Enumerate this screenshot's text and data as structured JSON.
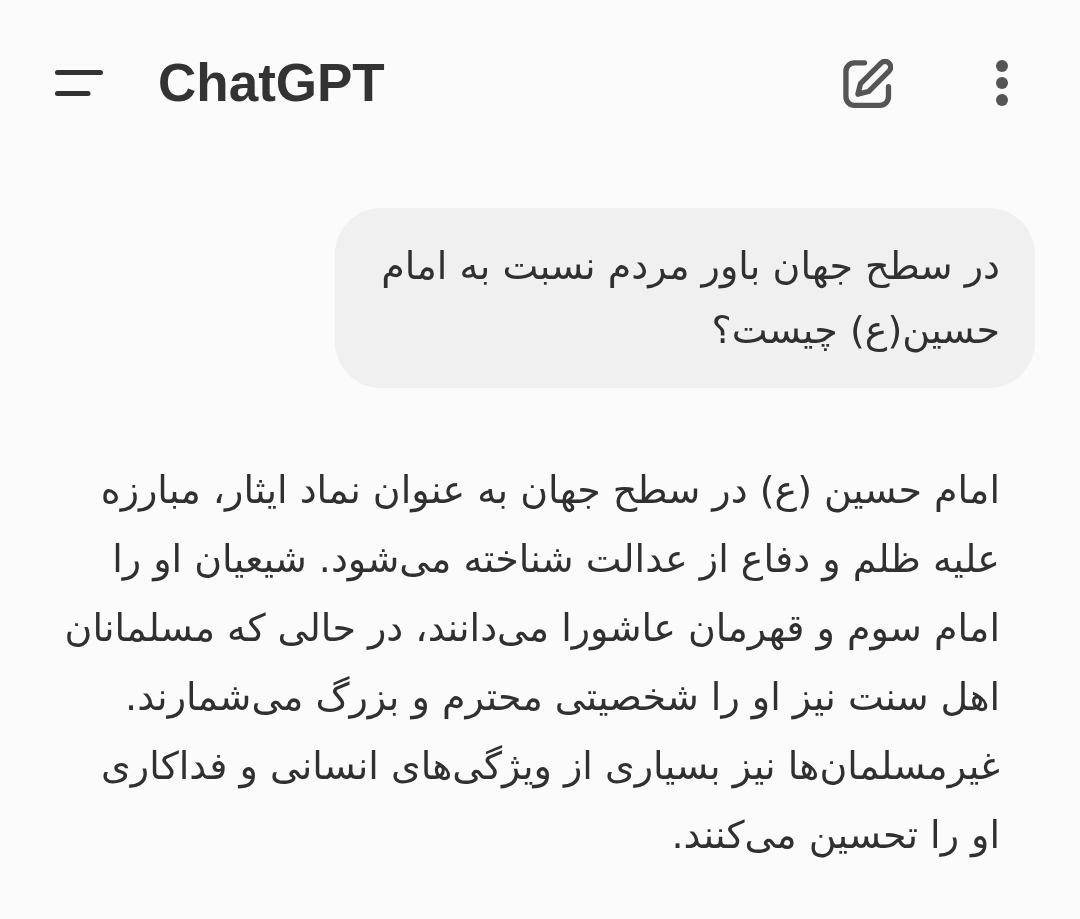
{
  "header": {
    "title": "ChatGPT"
  },
  "messages": [
    {
      "kind": "user",
      "text": "در سطح جهان باور مردم نسبت به امام حسین(ع) چیست؟"
    },
    {
      "kind": "assistant",
      "text": "امام حسین (ع) در سطح جهان به عنوان نماد ایثار، مبارزه علیه ظلم و دفاع از عدالت شناخته می‌شود. شیعیان او را امام سوم و قهرمان عاشورا می‌دانند، در حالی که مسلمانان اهل سنت نیز او را شخصیتی محترم و بزرگ می‌شمارند. غیرمسلمان‌ها نیز بسیاری از ویژگی‌های انسانی و فداکاری او را تحسین می‌کنند."
    }
  ]
}
